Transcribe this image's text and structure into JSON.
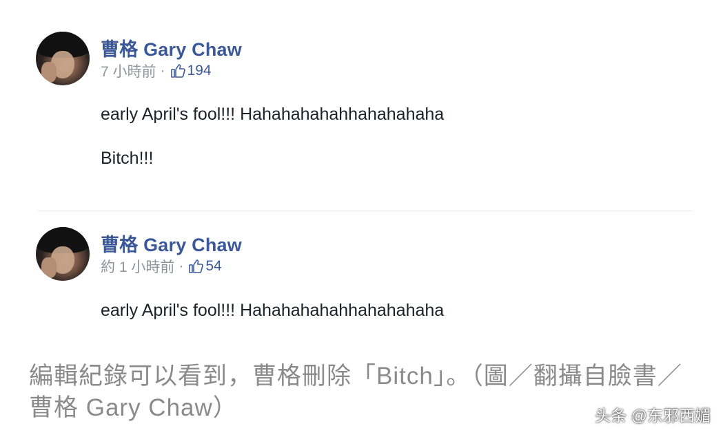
{
  "comments": [
    {
      "author": "曹格 Gary Chaw",
      "time": "7 小時前",
      "separator": "·",
      "likes": "194",
      "lines": [
        "early April's fool!!! Hahahahahahhahahahaha",
        "Bitch!!!"
      ]
    },
    {
      "author": "曹格 Gary Chaw",
      "time": "約 1 小時前",
      "separator": "·",
      "likes": "54",
      "lines": [
        "early April's fool!!! Hahahahahahhahahahaha"
      ]
    }
  ],
  "caption": {
    "text": "編輯紀錄可以看到，曹格刪除「Bitch」。（圖／翻攝自臉書／曹格 Gary Chaw）"
  },
  "watermark": {
    "text": "头条 @东邪西媚"
  },
  "icons": {
    "like": "thumbs-up-icon",
    "avatar": "avatar"
  },
  "colors": {
    "author_name": "#3b5998",
    "meta_text": "#90949c",
    "body_text": "#1d2129",
    "caption_text": "#8a8a8a"
  }
}
